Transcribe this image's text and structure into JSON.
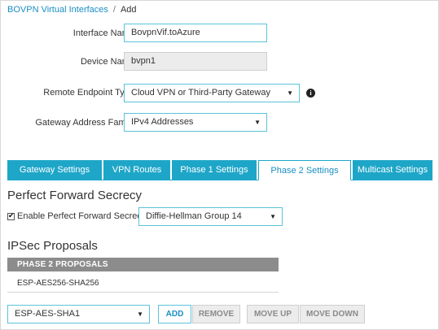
{
  "breadcrumb": {
    "parent": "BOVPN Virtual Interfaces",
    "separator": "/",
    "current": "Add"
  },
  "form": {
    "interface_name_label": "Interface Name",
    "interface_name_value": "BovpnVif.toAzure",
    "device_name_label": "Device Name",
    "device_name_value": "bvpn1",
    "remote_endpoint_label": "Remote Endpoint Type",
    "remote_endpoint_value": "Cloud VPN or Third-Party Gateway",
    "gateway_family_label": "Gateway Address Family",
    "gateway_family_value": "IPv4 Addresses",
    "info_icon_glyph": "i"
  },
  "tabs": [
    {
      "label": "Gateway Settings",
      "active": false
    },
    {
      "label": "VPN Routes",
      "active": false
    },
    {
      "label": "Phase 1 Settings",
      "active": false
    },
    {
      "label": "Phase 2 Settings",
      "active": true
    },
    {
      "label": "Multicast Settings",
      "active": false
    }
  ],
  "pfs": {
    "title": "Perfect Forward Secrecy",
    "checkbox_label": "Enable Perfect Forward Secrecy",
    "checked": true,
    "group_value": "Diffie-Hellman Group 14"
  },
  "ipsec": {
    "title": "IPSec Proposals",
    "table_header": "PHASE 2 PROPOSALS",
    "rows": [
      "ESP-AES256-SHA256"
    ],
    "proposal_select_value": "ESP-AES-SHA1",
    "add_label": "ADD",
    "remove_label": "REMOVE",
    "move_up_label": "MOVE UP",
    "move_down_label": "MOVE DOWN"
  },
  "colors": {
    "accent": "#1ea6c8",
    "link": "#1a8fc4",
    "table_header": "#8c8c8c"
  }
}
